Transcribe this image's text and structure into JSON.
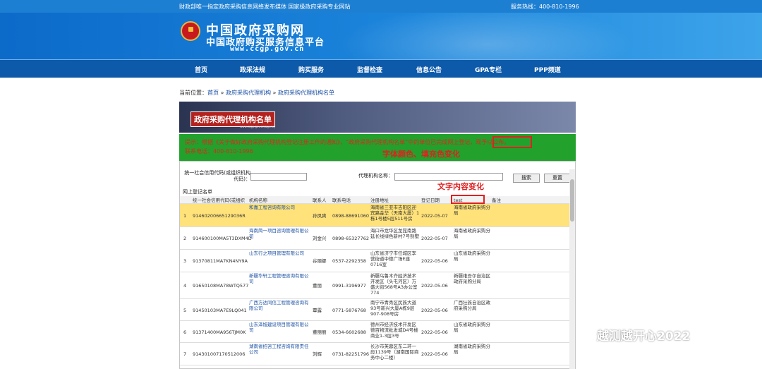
{
  "top": {
    "left": "财政部唯一指定政府采购信息网络发布媒体 国家级政府采购专业网站",
    "right": "服务热线：400-810-1996"
  },
  "logo": {
    "line1": "中国政府采购网",
    "line2": "中国政府购买服务信息平台",
    "url": "www.ccgp.gov.cn"
  },
  "nav": [
    "首页",
    "政采法规",
    "购买服务",
    "监督检查",
    "信息公告",
    "GPA专栏",
    "PPP频道"
  ],
  "breadcrumb": {
    "prefix": "当前位置：",
    "home": "首页",
    "sep1": " » ",
    "mid": "政府采购代理机构",
    "sep2": " » ",
    "current": "政府采购代理机构名单"
  },
  "header": {
    "title": "政府采购代理机构名单",
    "sub": "www.ccgp.gov.cn/agency"
  },
  "notice": {
    "text": "提示：根据《关于做好政府采购代理机构登记注册工作的通知》，“政府采购代理机构名单”中的单位已完成网上登记，现予以公布。",
    "phone": "联系电话：400-810-1996"
  },
  "annotations": {
    "color_change": "字体颜色、填充色变化",
    "text_change": "文字内容变化"
  },
  "search": {
    "code_label": "统一社会信用代码(或组织机构代码)：",
    "name_label": "代理机构名称：",
    "search_btn": "搜索",
    "reset_btn": "重置"
  },
  "section": "网上登记名单",
  "columns": [
    "",
    "统一社会信用代码(或组织",
    "机构名称",
    "联系人",
    "联系电话",
    "注册地址",
    "登记日期",
    "test",
    "备注"
  ],
  "rows": [
    {
      "n": "1",
      "code": "91460200665129036R",
      "name": "和嘉工程咨询有限公司",
      "person": "孙凤爽",
      "phone": "0898-88691060",
      "addr": "海南省三亚市吉阳区迎宾路金华（天南大厦）1栋1号楼5层511号房",
      "date": "2022-05-07",
      "org": "海南省政府采购分局"
    },
    {
      "n": "2",
      "code": "914600100MA5T3DXM4D",
      "name": "海南简一项目咨询管理有限公司",
      "person": "刘金兴",
      "phone": "0898-65327762",
      "addr": "海口市龙华区龙昆南路延长线绿色新村7号别墅",
      "date": "2022-05-07",
      "org": "海南省政府采购分局"
    },
    {
      "n": "3",
      "code": "91370811MA7KN4NY9A",
      "name": "山东行之项目管理有限公司",
      "person": "谷丽娜",
      "phone": "0537-2292358",
      "addr": "山东省济宁市任城区李营街道中德广场E座0716室",
      "date": "2022-05-06",
      "org": "山东省政府采购分局"
    },
    {
      "n": "4",
      "code": "91650108MA78WTQ577",
      "name": "新疆华轩工程管理咨询有限公司",
      "person": "董丽",
      "phone": "0991-3196977",
      "addr": "新疆乌鲁木齐经济技术开发区（头屯河区）万盛大街568号A3办公室774",
      "date": "2022-05-06",
      "org": "新疆维吾尔自治区政府采购分局"
    },
    {
      "n": "5",
      "code": "91450103MA7E9LQ041",
      "name": "广西方达同信工程管理咨询有限公司",
      "person": "覃露",
      "phone": "0771-5876768",
      "addr": "南宁市青秀区民族大道93号新兴大厦A栋9层907-908号房",
      "date": "2022-05-06",
      "org": "广西壮族自治区政府采购分局"
    },
    {
      "n": "6",
      "code": "91371400MA956TJM0K",
      "name": "山东泽旭建设项目管理有限公司",
      "person": "董丽丽",
      "phone": "0534-6602688",
      "addr": "德州市经济技术开发区德百物流批发城D4号楼商业1-3层3号",
      "date": "2022-05-06",
      "org": "山东省政府采购分局"
    },
    {
      "n": "7",
      "code": "914301007170512006",
      "name": "湖南省招咨工程咨询有限责任公司",
      "person": "刘辉",
      "phone": "0731-82251796",
      "addr": "长沙市芙蓉区东二环一段1139号（湖南国际商务中心二楼）",
      "date": "2022-05-06",
      "org": "湖南省政府采购分局"
    }
  ],
  "watermark": "越测越开心2022",
  "colors": {
    "nav": "#0e5aaa",
    "notice_bg": "#22a12c",
    "highlight": "#ffe27a",
    "red": "#e02020"
  }
}
